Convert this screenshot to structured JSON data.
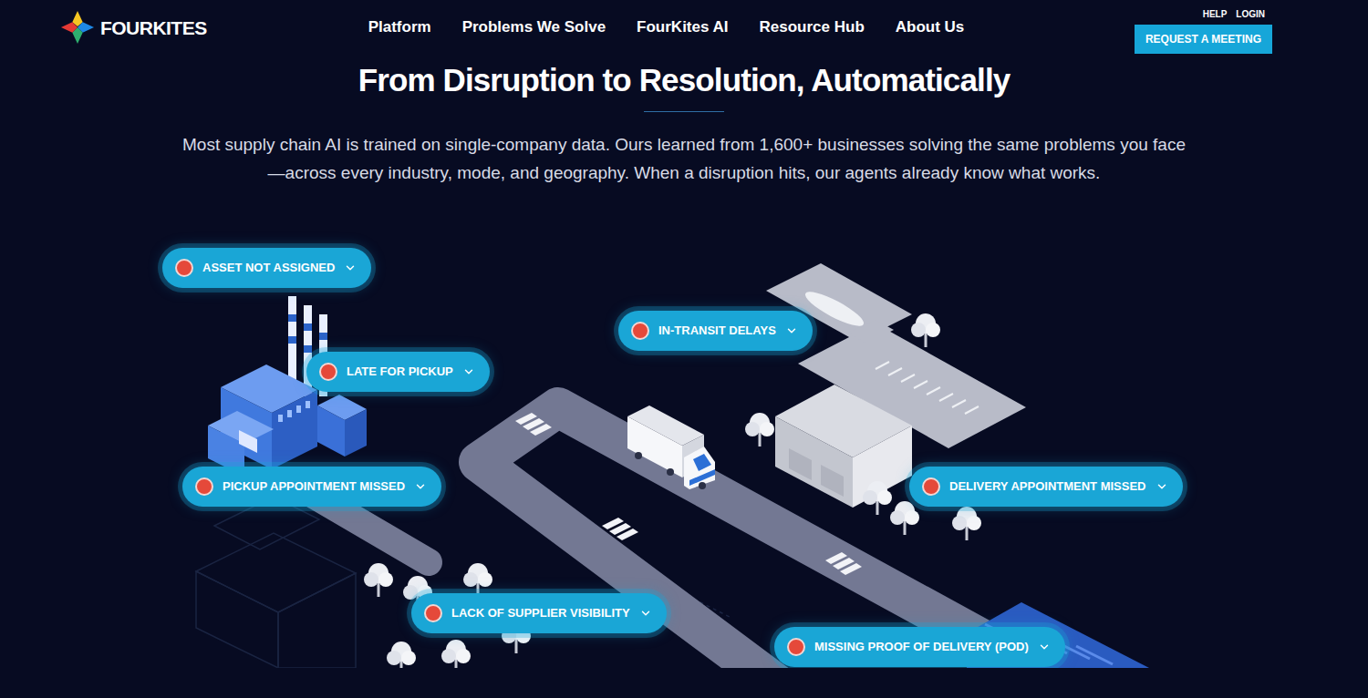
{
  "header": {
    "logo": "FOURKITES",
    "nav": [
      "Platform",
      "Problems We Solve",
      "FourKites AI",
      "Resource Hub",
      "About Us"
    ],
    "utility": [
      "HELP",
      "LOGIN"
    ],
    "cta": "REQUEST A MEETING"
  },
  "hero": {
    "title": "From Disruption to Resolution, Automatically",
    "description": "Most supply chain AI is trained on single-company data. Ours learned from 1,600+ businesses solving the same problems you face—across every industry, mode, and geography. When a disruption hits, our agents already know what works."
  },
  "disruptions": [
    {
      "label": "ASSET NOT ASSIGNED",
      "expanded": false
    },
    {
      "label": "LATE FOR PICKUP",
      "expanded": false
    },
    {
      "label": "IN-TRANSIT DELAYS",
      "expanded": false
    },
    {
      "label": "PICKUP APPOINTMENT MISSED",
      "expanded": false
    },
    {
      "label": "DELIVERY APPOINTMENT MISSED",
      "expanded": false
    },
    {
      "label": "LACK OF SUPPLIER VISIBILITY",
      "expanded": false
    },
    {
      "label": "MISSING PROOF OF DELIVERY (POD)",
      "expanded": false
    }
  ]
}
